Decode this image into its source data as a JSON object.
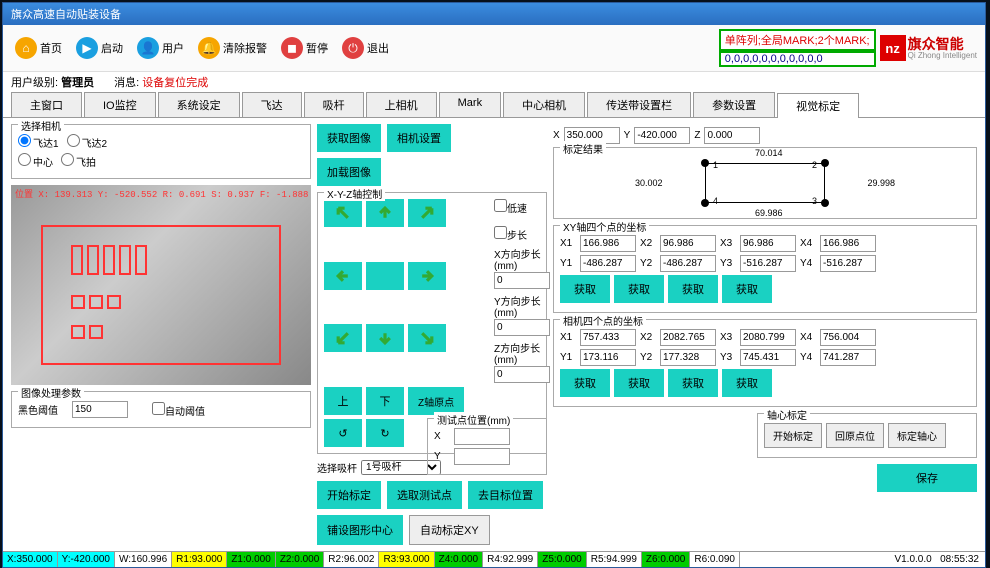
{
  "window_title": "旗众高速自动贴装设备",
  "toolbar": [
    {
      "icon": "home",
      "color": "#f6a500",
      "label": "首页"
    },
    {
      "icon": "play",
      "color": "#1a9fe0",
      "label": "启动"
    },
    {
      "icon": "user",
      "color": "#1a9fe0",
      "label": "用户"
    },
    {
      "icon": "bell",
      "color": "#f6a500",
      "label": "清除报警"
    },
    {
      "icon": "stop",
      "color": "#e04040",
      "label": "暂停"
    },
    {
      "icon": "power",
      "color": "#e04040",
      "label": "退出"
    }
  ],
  "banner_top": "单阵列;全局MARK;2个MARK;",
  "banner_bot": "0,0,0,0,0,0,0,0,0,0,0",
  "logo_cn": "旗众智能",
  "logo_en": "Qi Zhong Intelligent",
  "subbar": {
    "a": "用户级别:",
    "b": "管理员",
    "c": "消息:",
    "d": "设备复位完成"
  },
  "tabs": [
    "主窗口",
    "IO监控",
    "系统设定",
    "飞达",
    "吸杆",
    "上相机",
    "Mark",
    "中心相机",
    "传送带设置栏",
    "参数设置",
    "视觉标定"
  ],
  "active_tab": 10,
  "cam_select": {
    "title": "选择相机",
    "opts": [
      "飞达1",
      "飞达2",
      "中心",
      "飞拍"
    ]
  },
  "btns_img": {
    "a": "获取图像",
    "b": "相机设置",
    "c": "加载图像"
  },
  "coords_xyz": {
    "x": "350.000",
    "y": "-420.000",
    "z": "0.000"
  },
  "cam_info": "位置 X: 139.313 Y: -520.552 R: 0.691 S: 0.937 F: -1.888",
  "xyz_panel": {
    "title": "X-Y-Z轴控制",
    "btn_up": "上",
    "btn_down": "下",
    "btn_zorigin": "Z轴原点",
    "chk_low": "低速",
    "chk_step": "步长",
    "lab_x": "X方向步长(mm)",
    "lab_y": "Y方向步长(mm)",
    "lab_z": "Z方向步长(mm)",
    "val_x": "0",
    "val_y": "0",
    "val_z": "0"
  },
  "calib_result": {
    "title": "标定结果",
    "top": "70.014",
    "right": "29.998",
    "left": "30.002",
    "bottom": "69.986"
  },
  "xy_points": {
    "title": "XY轴四个点的坐标",
    "rows": [
      {
        "X1": "166.986",
        "X2": "96.986",
        "X3": "96.986",
        "X4": "166.986"
      },
      {
        "Y1": "-486.287",
        "Y2": "-486.287",
        "Y3": "-516.287",
        "Y4": "-516.287"
      }
    ],
    "btn": "获取"
  },
  "cam_points": {
    "title": "相机四个点的坐标",
    "rows": [
      {
        "X1": "757.433",
        "X2": "2082.765",
        "X3": "2080.799",
        "X4": "756.004"
      },
      {
        "Y1": "173.116",
        "Y2": "177.328",
        "Y3": "745.431",
        "Y4": "741.287"
      }
    ],
    "btn": "获取"
  },
  "center_calib": {
    "title": "轴心标定",
    "b1": "开始标定",
    "b2": "回原点位",
    "b3": "标定轴心"
  },
  "img_proc": {
    "title": "图像处理参数",
    "lab": "黑色阈值",
    "val": "150",
    "chk": "自动阈值"
  },
  "pick_rod": {
    "lab": "选择吸杆",
    "val": "1号吸杆"
  },
  "test_point": {
    "title": "测试点位置(mm)",
    "x": "X",
    "y": "Y"
  },
  "action_btns": {
    "b1": "开始标定",
    "b2": "选取测试点",
    "b3": "去目标位置",
    "b4": "保存",
    "b5": "铺设图形中心",
    "b6": "自动标定XY"
  },
  "statusbar": {
    "cells": [
      "X:350.000",
      "Y:-420.000",
      "W:160.996",
      "R1:93.000",
      "Z1:0.000",
      "Z2:0.000",
      "R2:96.002",
      "R3:93.000",
      "Z4:0.000",
      "R4:92.999",
      "Z5:0.000",
      "R5:94.999",
      "Z6:0.000",
      "R6:0.090"
    ],
    "version": "V1.0.0.0",
    "time": "08:55:32"
  }
}
